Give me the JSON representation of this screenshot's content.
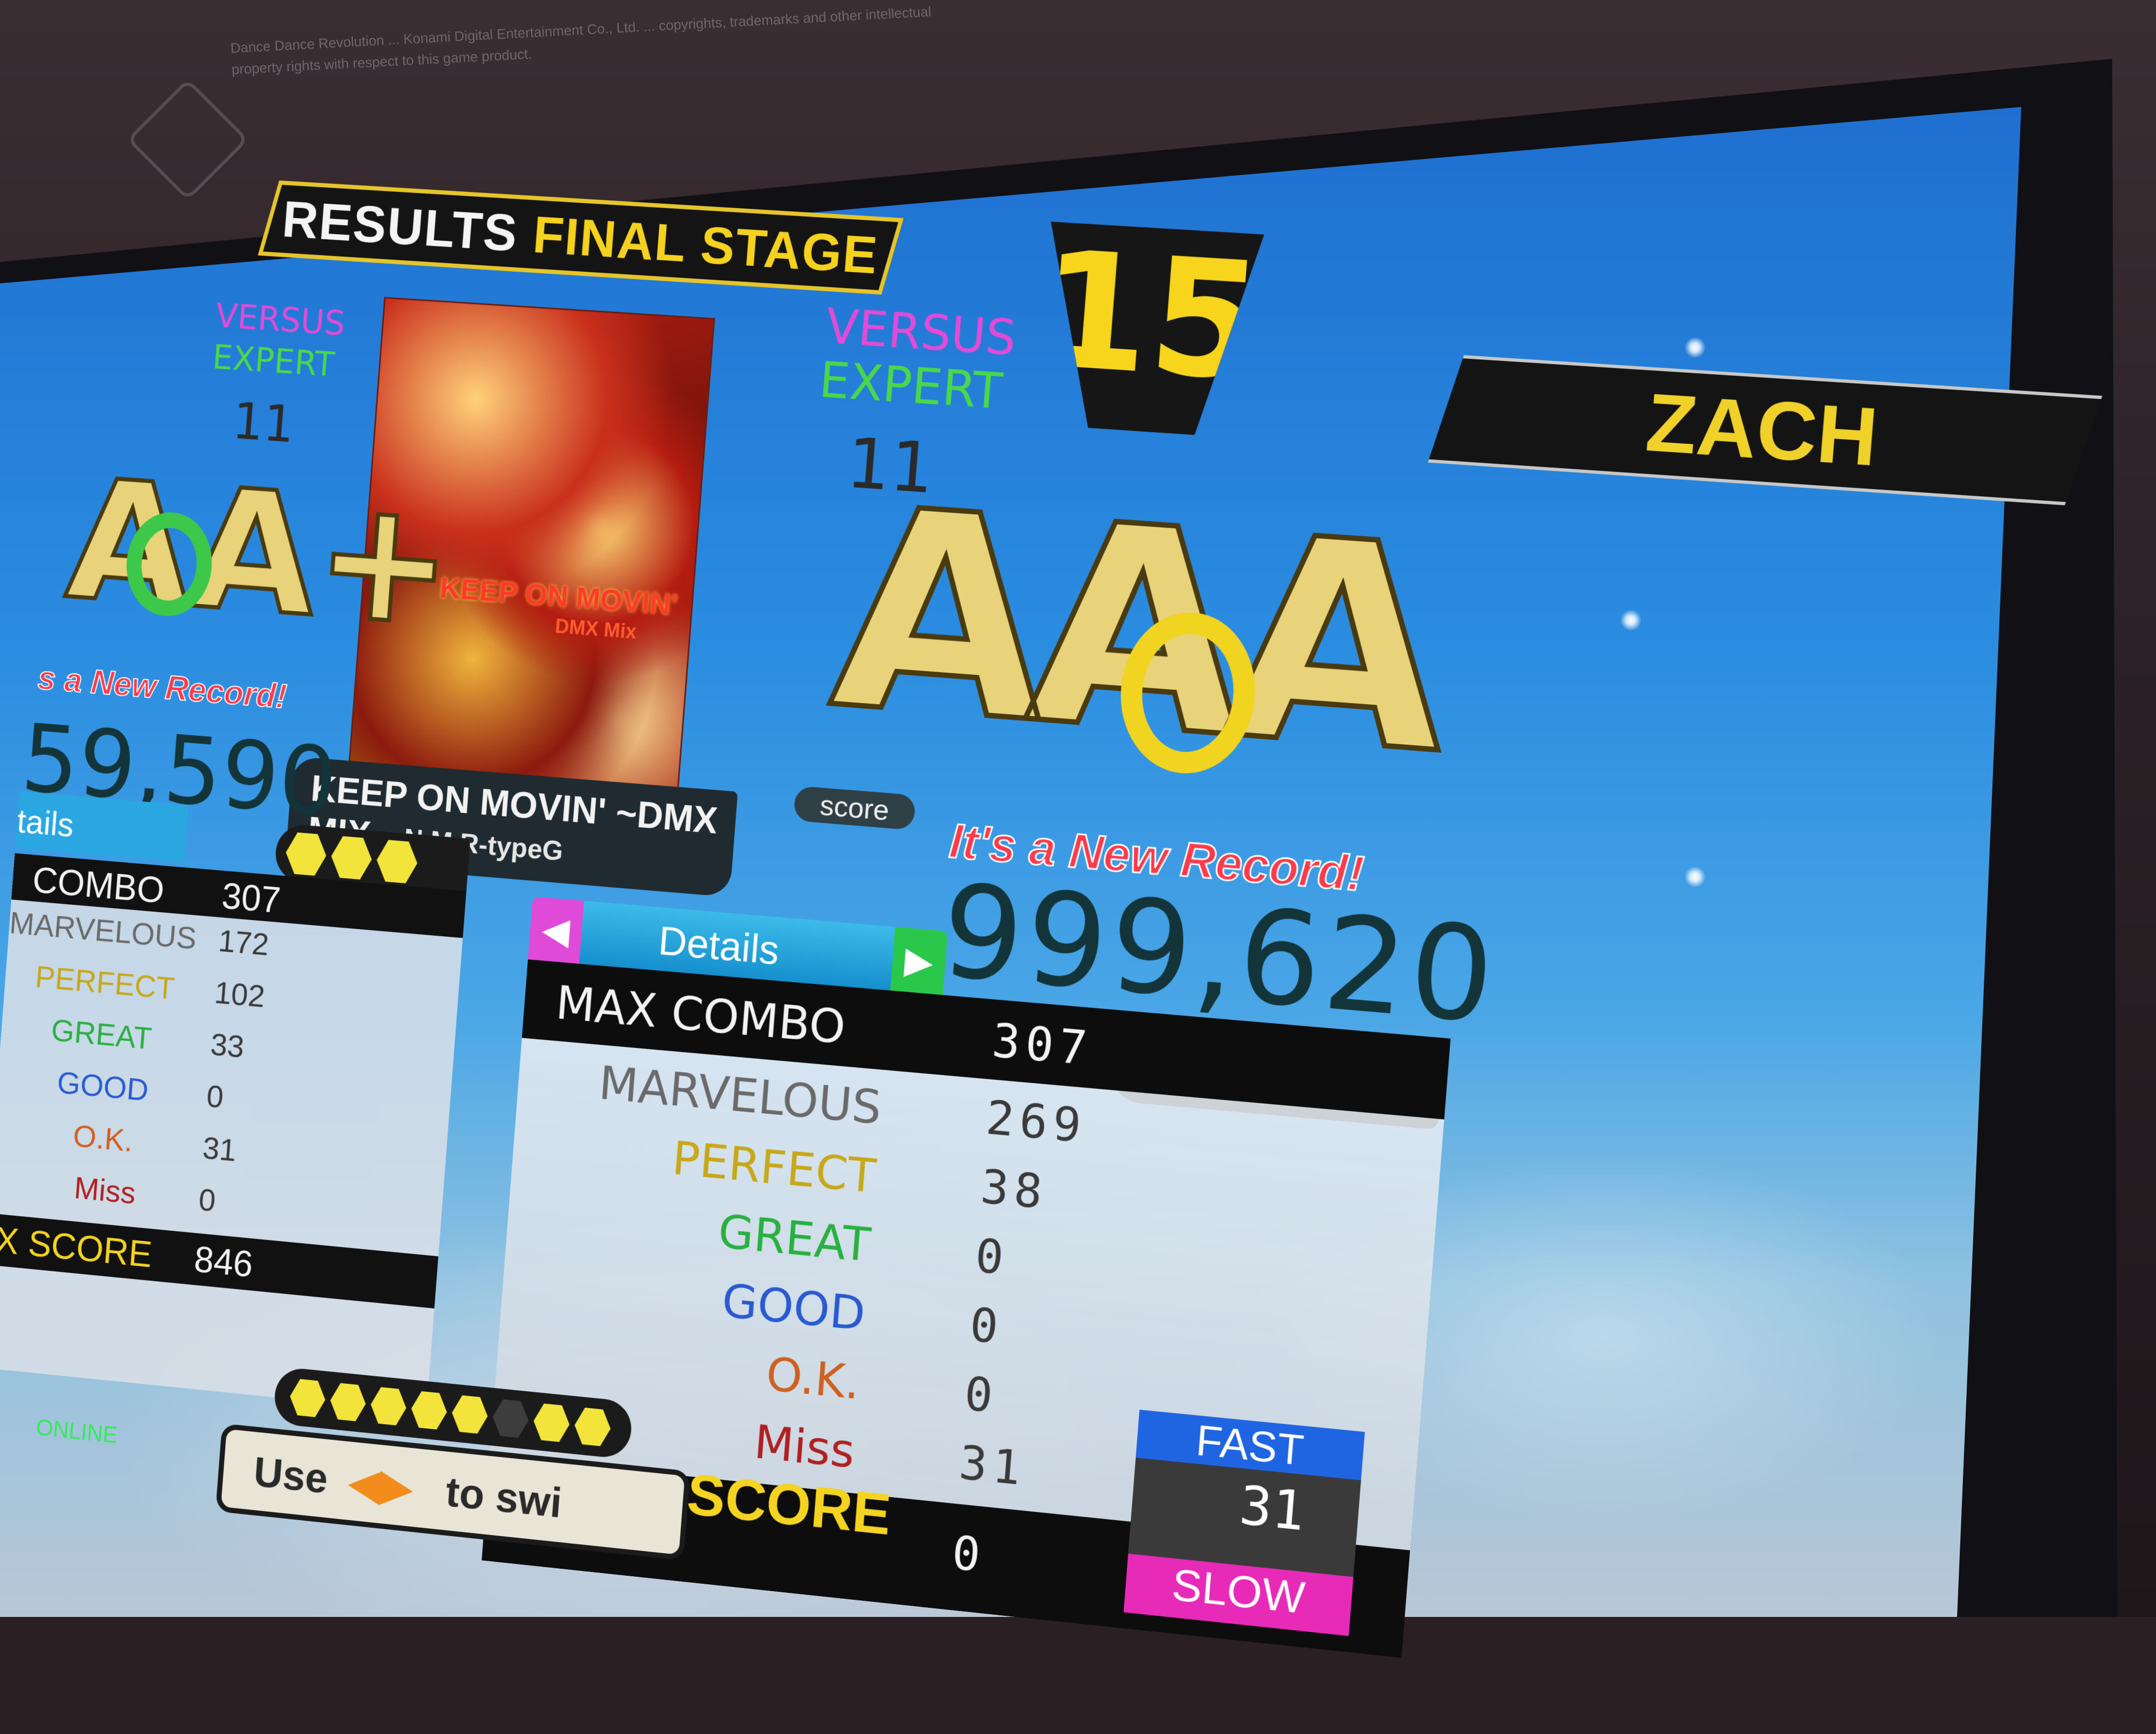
{
  "wall": {
    "notice": "Dance Dance Revolution ... Konami Digital Entertainment Co., Ltd. ... copyrights, trademarks and other intellectual property rights with respect to this game product."
  },
  "header": {
    "results_word": "RESULTS",
    "stage_word": "FINAL STAGE",
    "stage_number": "15",
    "player_name": "ZACH"
  },
  "song": {
    "jacket_title": "KEEP ON MOVIN'",
    "jacket_sub": "DMX Mix",
    "title": "KEEP ON MOVIN' ~DMX MIX~",
    "artist": "N.M.R-typeG"
  },
  "player": {
    "mode": "VERSUS",
    "difficulty": "EXPERT",
    "level": "11",
    "grade": "AAA",
    "score_tag": "score",
    "new_record": "It's a New Record!",
    "score": "999,620",
    "gauge_lit": 3,
    "details_tab": "Details",
    "rows": [
      {
        "label": "MAX COMBO",
        "value": "307",
        "color": "#f2f2f2"
      },
      {
        "label": "MARVELOUS",
        "value": "269",
        "color": "#6a6a6a"
      },
      {
        "label": "PERFECT",
        "value": "38",
        "color": "#e0c020"
      },
      {
        "label": "GREAT",
        "value": "0",
        "color": "#2ab040"
      },
      {
        "label": "GOOD",
        "value": "0",
        "color": "#2a5ad0"
      },
      {
        "label": "O.K.",
        "value": "0",
        "color": "#d06020"
      },
      {
        "label": "Miss",
        "value": "31",
        "color": "#b02020"
      }
    ],
    "ex_score_label": "EX SCORE",
    "ex_score": "0",
    "fast_label": "FAST",
    "fast_value": "31",
    "slow_label": "SLOW"
  },
  "opponent": {
    "mode": "VERSUS",
    "difficulty": "EXPERT",
    "level": "11",
    "grade": "AA+",
    "new_record": "s a New Record!",
    "score": "59,590",
    "details_tab": "tails",
    "rows": [
      {
        "label": "COMBO",
        "value": "307"
      },
      {
        "label": "MARVELOUS",
        "value": "172"
      },
      {
        "label": "PERFECT",
        "value": "102"
      },
      {
        "label": "GREAT",
        "value": "33"
      },
      {
        "label": "GOOD",
        "value": "0"
      },
      {
        "label": "O.K.",
        "value": "31"
      },
      {
        "label": "Miss",
        "value": "0"
      },
      {
        "label": "X SCORE",
        "value": "846"
      }
    ]
  },
  "footer": {
    "prompt_use": "Use",
    "prompt_rest": "to swi",
    "online": "ONLINE"
  }
}
